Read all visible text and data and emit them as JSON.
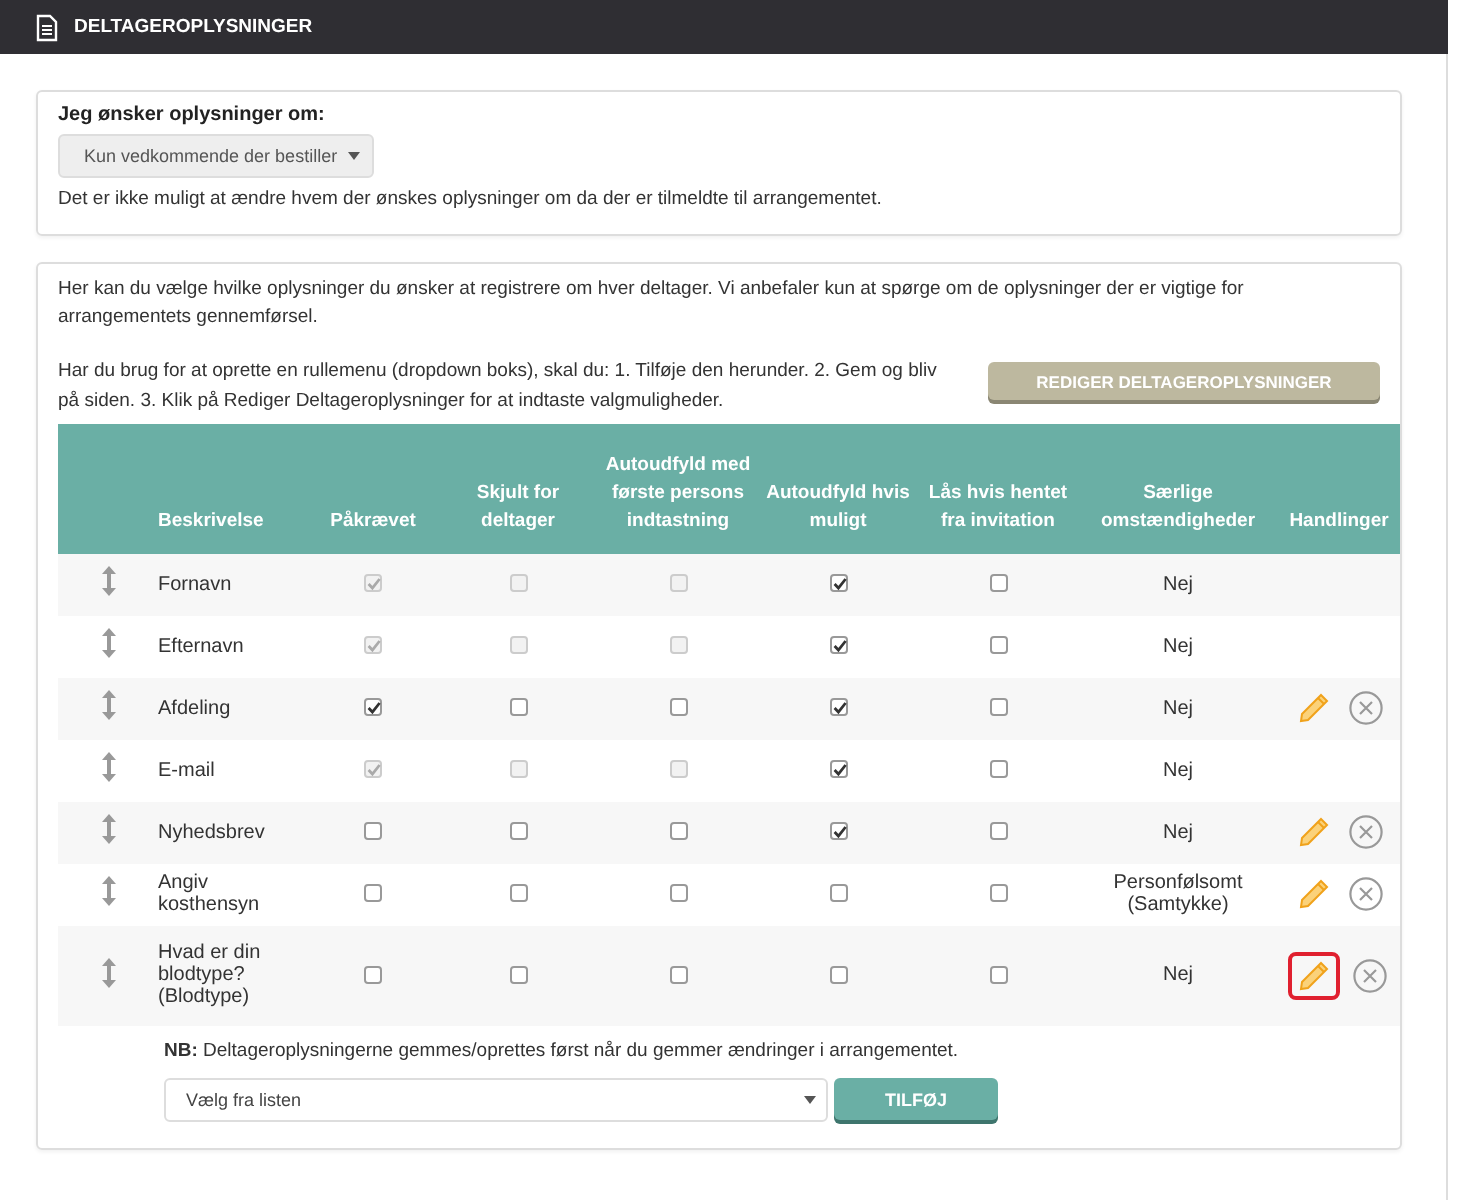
{
  "header": {
    "title": "DELTAGEROPLYSNINGER"
  },
  "recipient": {
    "label": "Jeg ønsker oplysninger om:",
    "select_value": "Kun vedkommende der bestiller",
    "note": "Det er ikke muligt at ændre hvem der ønskes oplysninger om da der er tilmeldte til arrangementet."
  },
  "fields_panel": {
    "intro": "Her kan du vælge hvilke oplysninger du ønsker at registrere om hver deltager. Vi anbefaler kun at spørge om de oplysninger der er vigtige for arrangementets gennemførsel.",
    "help": "Har du brug for at oprette en rullemenu (dropdown boks), skal du: 1. Tilføje den herunder. 2. Gem og bliv på siden. 3. Klik på Rediger Deltageroplysninger for at indtaste valgmuligheder.",
    "edit_button": "REDIGER DELTAGEROPLYSNINGER",
    "table": {
      "columns": [
        "Beskrivelse",
        "Påkrævet",
        "Skjult for deltager",
        "Autoudfyld med første persons indtastning",
        "Autoudfyld hvis muligt",
        "Lås hvis hentet fra invitation",
        "Særlige omstændigheder",
        "Handlinger"
      ],
      "rows": [
        {
          "description": "Fornavn",
          "checks": [
            {
              "checked": true,
              "disabled": true
            },
            {
              "checked": false,
              "disabled": true
            },
            {
              "checked": false,
              "disabled": true
            },
            {
              "checked": true,
              "disabled": false
            },
            {
              "checked": false,
              "disabled": false
            }
          ],
          "special": "Nej",
          "actions": false
        },
        {
          "description": "Efternavn",
          "checks": [
            {
              "checked": true,
              "disabled": true
            },
            {
              "checked": false,
              "disabled": true
            },
            {
              "checked": false,
              "disabled": true
            },
            {
              "checked": true,
              "disabled": false
            },
            {
              "checked": false,
              "disabled": false
            }
          ],
          "special": "Nej",
          "actions": false
        },
        {
          "description": "Afdeling",
          "checks": [
            {
              "checked": true,
              "disabled": false
            },
            {
              "checked": false,
              "disabled": false
            },
            {
              "checked": false,
              "disabled": false
            },
            {
              "checked": true,
              "disabled": false
            },
            {
              "checked": false,
              "disabled": false
            }
          ],
          "special": "Nej",
          "actions": true,
          "edit_highlighted": false
        },
        {
          "description": "E-mail",
          "checks": [
            {
              "checked": true,
              "disabled": true
            },
            {
              "checked": false,
              "disabled": true
            },
            {
              "checked": false,
              "disabled": true
            },
            {
              "checked": true,
              "disabled": false
            },
            {
              "checked": false,
              "disabled": false
            }
          ],
          "special": "Nej",
          "actions": false
        },
        {
          "description": "Nyhedsbrev",
          "checks": [
            {
              "checked": false,
              "disabled": false
            },
            {
              "checked": false,
              "disabled": false
            },
            {
              "checked": false,
              "disabled": false
            },
            {
              "checked": true,
              "disabled": false
            },
            {
              "checked": false,
              "disabled": false
            }
          ],
          "special": "Nej",
          "actions": true,
          "edit_highlighted": false
        },
        {
          "description": "Angiv kosthensyn",
          "checks": [
            {
              "checked": false,
              "disabled": false
            },
            {
              "checked": false,
              "disabled": false
            },
            {
              "checked": false,
              "disabled": false
            },
            {
              "checked": false,
              "disabled": false
            },
            {
              "checked": false,
              "disabled": false
            }
          ],
          "special": "Personfølsomt (Samtykke)",
          "actions": true,
          "edit_highlighted": false
        },
        {
          "description": "Hvad er din blodtype? (Blodtype)",
          "checks": [
            {
              "checked": false,
              "disabled": false
            },
            {
              "checked": false,
              "disabled": false
            },
            {
              "checked": false,
              "disabled": false
            },
            {
              "checked": false,
              "disabled": false
            },
            {
              "checked": false,
              "disabled": false
            }
          ],
          "special": "Nej",
          "actions": true,
          "edit_highlighted": true
        }
      ]
    },
    "nb_note": "**NB:** Deltageroplysningerne gemmes/oprettes først når du gemmer ændringer i arrangementet.",
    "add_select": "Vælg fra listen",
    "add_button": "TILFØJ"
  }
}
